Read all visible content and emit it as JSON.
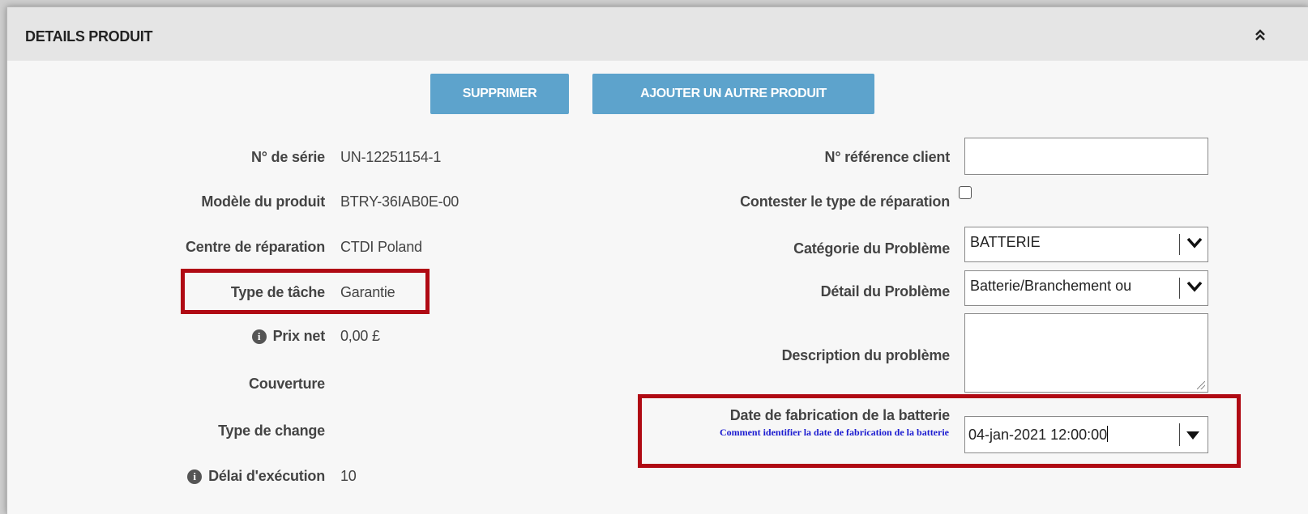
{
  "panel": {
    "title": "DETAILS PRODUIT",
    "collapse_icon": "double-chevron-up-icon"
  },
  "buttons": {
    "delete": "SUPPRIMER",
    "add_product": "AJOUTER UN AUTRE PRODUIT"
  },
  "left_fields": {
    "serial": {
      "label": "N° de série",
      "value": "UN-12251154-1"
    },
    "model": {
      "label": "Modèle du produit",
      "value": "BTRY-36IAB0E-00"
    },
    "repair_center": {
      "label": "Centre de réparation",
      "value": "CTDI Poland"
    },
    "task_type": {
      "label": "Type de tâche",
      "value": "Garantie"
    },
    "net_price": {
      "label": "Prix net",
      "value": "0,00 £",
      "icon": "info-icon"
    },
    "coverage": {
      "label": "Couverture",
      "value": ""
    },
    "exchange_type": {
      "label": "Type de change",
      "value": ""
    },
    "lead_time": {
      "label": "Délai d'exécution",
      "value": "10",
      "icon": "info-icon"
    }
  },
  "right_fields": {
    "client_ref": {
      "label": "N° référence client",
      "value": ""
    },
    "contest_repair": {
      "label": "Contester le type de réparation",
      "checked": false
    },
    "problem_category": {
      "label": "Catégorie du Problème",
      "value": "BATTERIE"
    },
    "problem_detail": {
      "label": "Détail du Problème",
      "value": "Batterie/Branchement ou"
    },
    "problem_description": {
      "label": "Description du problème",
      "value": ""
    },
    "battery_date": {
      "label": "Date de fabrication de la batterie",
      "help_link": "Comment identifier la date de fabrication de la batterie",
      "value": "04-jan-2021 12:00:00"
    }
  },
  "colors": {
    "button_bg": "#5da3cc",
    "highlight": "#b00a14",
    "link": "#1a1ad0",
    "header_bg": "#e5e5e5"
  }
}
